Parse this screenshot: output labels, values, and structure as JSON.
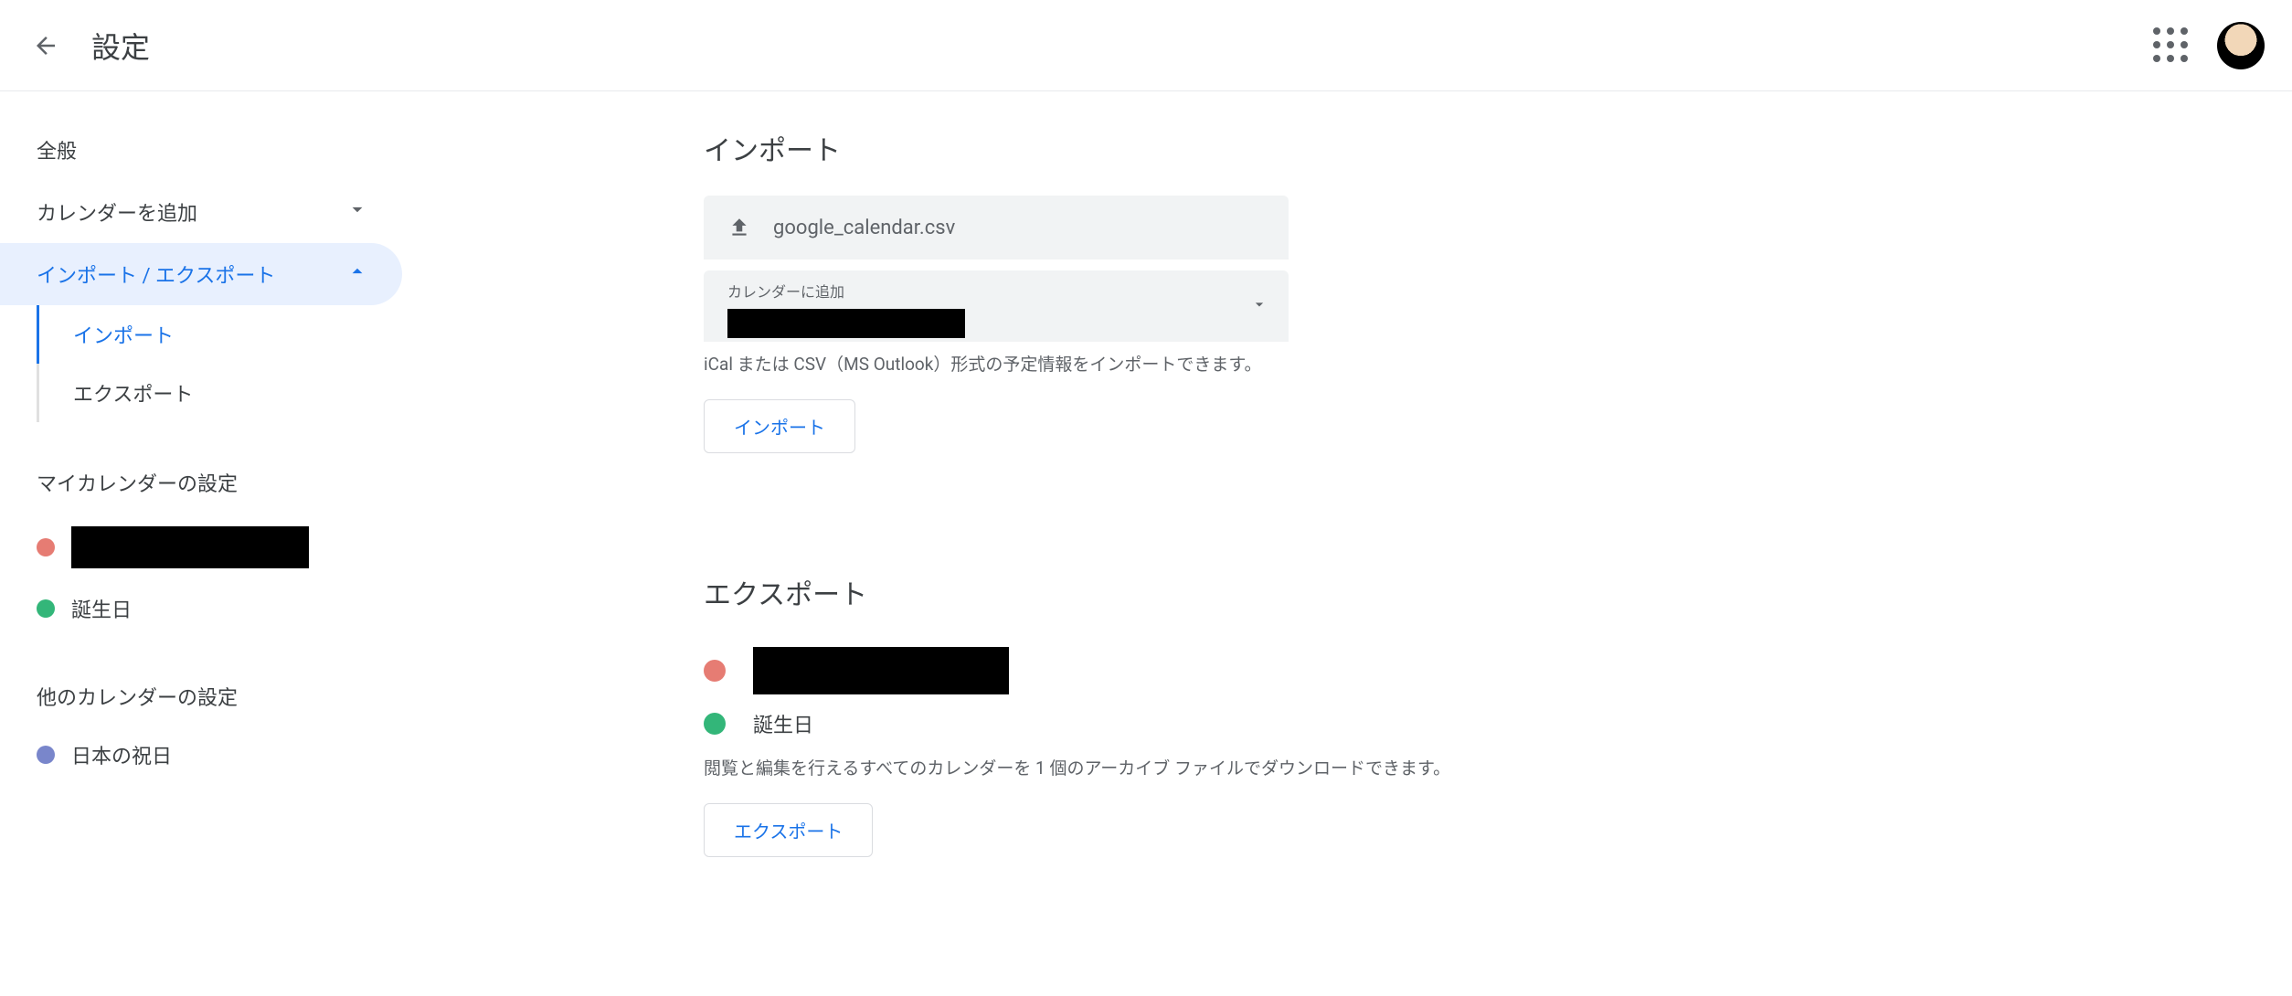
{
  "header": {
    "title": "設定"
  },
  "sidebar": {
    "general": "全般",
    "add_calendar": "カレンダーを追加",
    "import_export": "インポート / エクスポート",
    "import": "インポート",
    "export": "エクスポート",
    "my_calendars_header": "マイカレンダーの設定",
    "my_calendars": [
      {
        "color": "#e67c73",
        "label": "",
        "redacted": true
      },
      {
        "color": "#33b679",
        "label": "誕生日",
        "redacted": false
      }
    ],
    "other_calendars_header": "他のカレンダーの設定",
    "other_calendars": [
      {
        "color": "#7986cb",
        "label": "日本の祝日",
        "redacted": false
      }
    ]
  },
  "main": {
    "import": {
      "title": "インポート",
      "file_name": "google_calendar.csv",
      "dropdown_label": "カレンダーに追加",
      "helper": "iCal または CSV（MS Outlook）形式の予定情報をインポートできます。",
      "button": "インポート"
    },
    "export": {
      "title": "エクスポート",
      "calendars": [
        {
          "color": "#e67c73",
          "label": "",
          "redacted": true
        },
        {
          "color": "#33b679",
          "label": "誕生日",
          "redacted": false
        }
      ],
      "helper": "閲覧と編集を行えるすべてのカレンダーを 1 個のアーカイブ ファイルでダウンロードできます。",
      "button": "エクスポート"
    }
  }
}
